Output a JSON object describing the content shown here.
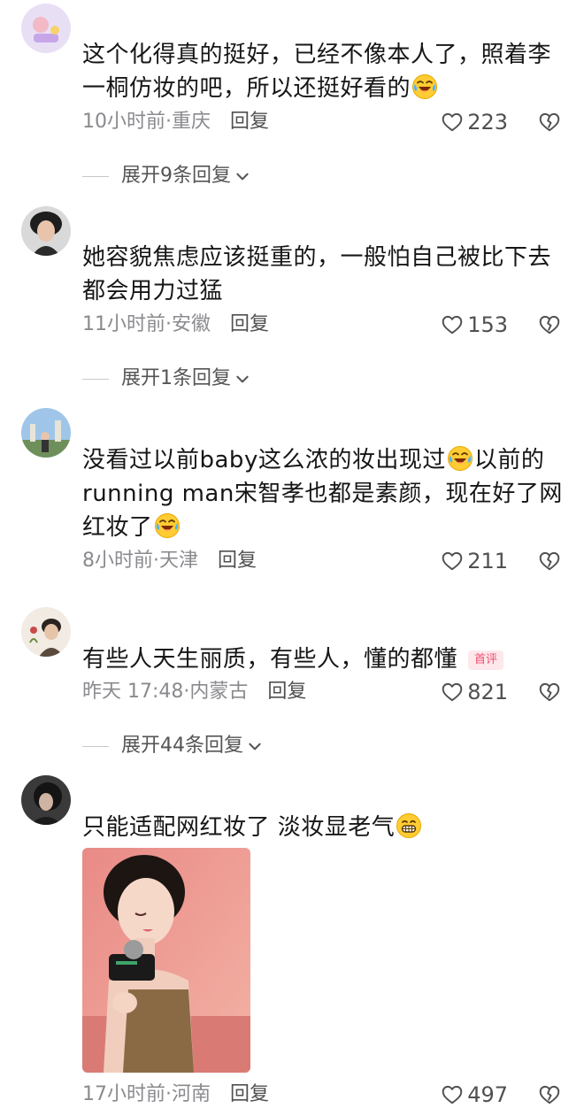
{
  "comments": [
    {
      "text_a": "这个化得真的挺好，已经不像本人了，照着李一桐仿妆的吧，所以还挺好看的",
      "time": "10小时前",
      "location": "·重庆",
      "reply": "回复",
      "likes": "223",
      "expand": "展开9条回复"
    },
    {
      "text_a": "她容貌焦虑应该挺重的，一般怕自己被比下去都会用力过猛",
      "time": "11小时前",
      "location": "·安徽",
      "reply": "回复",
      "likes": "153",
      "expand": "展开1条回复"
    },
    {
      "text_a": "没看过以前baby这么浓的妆出现过",
      "text_b": "以前的running man宋智孝也都是素颜，现在好了网红妆了",
      "time": "8小时前",
      "location": "·天津",
      "reply": "回复",
      "likes": "211"
    },
    {
      "text_a": "有些人天生丽质，有些人，懂的都懂",
      "badge": "首评",
      "time": "昨天 17:48",
      "location": "·内蒙古",
      "reply": "回复",
      "likes": "821",
      "expand": "展开44条回复"
    },
    {
      "text_a": "只能适配网红妆了 淡妆显老气",
      "time": "17小时前",
      "location": "·河南",
      "reply": "回复",
      "likes": "497"
    }
  ],
  "icons": {
    "like": "heart-outline-icon",
    "dislike": "broken-heart-icon",
    "expand": "chevron-down-icon",
    "emoji_laugh_cry": "laugh-cry-emoji",
    "emoji_grin": "grin-emoji"
  },
  "colors": {
    "text": "#161616",
    "meta": "#8a8a8f",
    "badge_bg": "#fde8ec",
    "badge_text": "#f04d6b"
  }
}
